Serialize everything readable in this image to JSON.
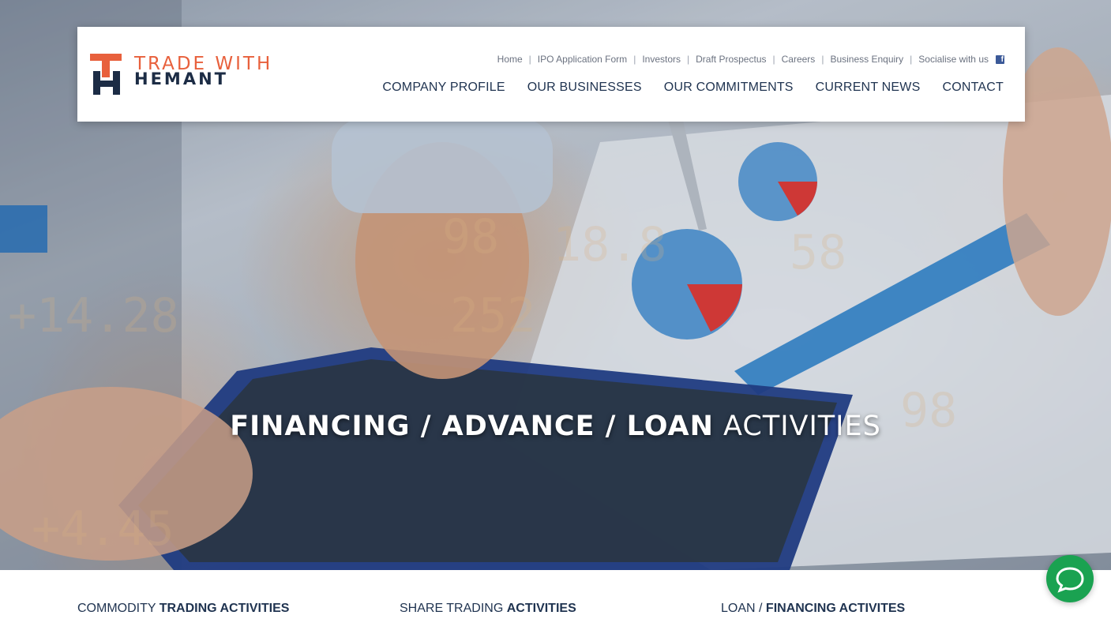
{
  "brand": {
    "line1": "TRADE WITH",
    "line2": "HEMANT",
    "colors": {
      "orange": "#e8603c",
      "navy": "#1c2c45"
    }
  },
  "toplinks": {
    "home": "Home",
    "ipo": "IPO Application Form",
    "investors": "Investors",
    "prospectus": "Draft Prospectus",
    "careers": "Careers",
    "enquiry": "Business Enquiry",
    "socialise": "Socialise with us",
    "facebook_icon": "f"
  },
  "nav": {
    "company": "COMPANY PROFILE",
    "businesses": "OUR BUSINESSES",
    "commitments": "OUR COMMITMENTS",
    "news": "CURRENT NEWS",
    "contact": "CONTACT"
  },
  "hero": {
    "title_part1": "FINANCING / ADVANCE / LOAN",
    "title_part2": "ACTIVITIES"
  },
  "sections": {
    "commodity_light": "COMMODITY",
    "commodity_bold": "TRADING ACTIVITIES",
    "share_light": "SHARE TRADING",
    "share_bold": "ACTIVITIES",
    "loan_light": "LOAN /",
    "loan_bold": "FINANCING ACTIVITES"
  },
  "chat": {
    "icon": "chat-bubble-icon",
    "color": "#1aa251"
  }
}
